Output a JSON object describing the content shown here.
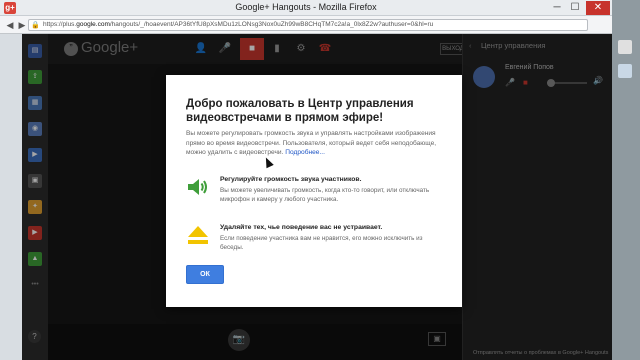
{
  "window": {
    "title": "Google+ Hangouts - Mozilla Firefox",
    "url_prefix": "https://plus.",
    "url_domain": "google.com",
    "url_path": "/hangouts/_/hoaevent/AP36tYfU8pXsMDu1zLONsg3Nox0uZh99wB8CHqTM7c2a!a_0lx8Z2w?authuser=0&hl=ru",
    "min": "─",
    "max": "☐",
    "close": "✕"
  },
  "app": {
    "brand": "Google+",
    "exit_label": "ВЫХОД"
  },
  "panel": {
    "title": "Центр управления",
    "person_name": "Евгений Попов",
    "footer": "Отправлять отчеты о проблемах в Google+ Hangouts"
  },
  "modal": {
    "title": "Добро пожаловать в Центр управления видеовстречами в прямом эфире!",
    "intro": "Вы можете регулировать громкость звука и управлять настройками изображения прямо во время видеовстречи. Пользователя, который ведет себя неподобающе, можно удалить с видеовстречи.",
    "more_link": "Подробнее...",
    "item1_title": "Регулируйте громкость звука участников.",
    "item1_text": "Вы можете увеличивать громкость, когда кто-то говорит, или отключать микрофон и камеру у любого участника.",
    "item2_title": "Удаляйте тех, чье поведение вас не устраивает.",
    "item2_text": "Если поведение участника вам не нравится, его можно исключить из беседы.",
    "ok_label": "ОК"
  },
  "colors": {
    "accent_blue": "#3f7ee0",
    "volume_green": "#3f9e3a",
    "eject_yellow": "#f2c400",
    "camera_off_red": "#c8372d"
  }
}
